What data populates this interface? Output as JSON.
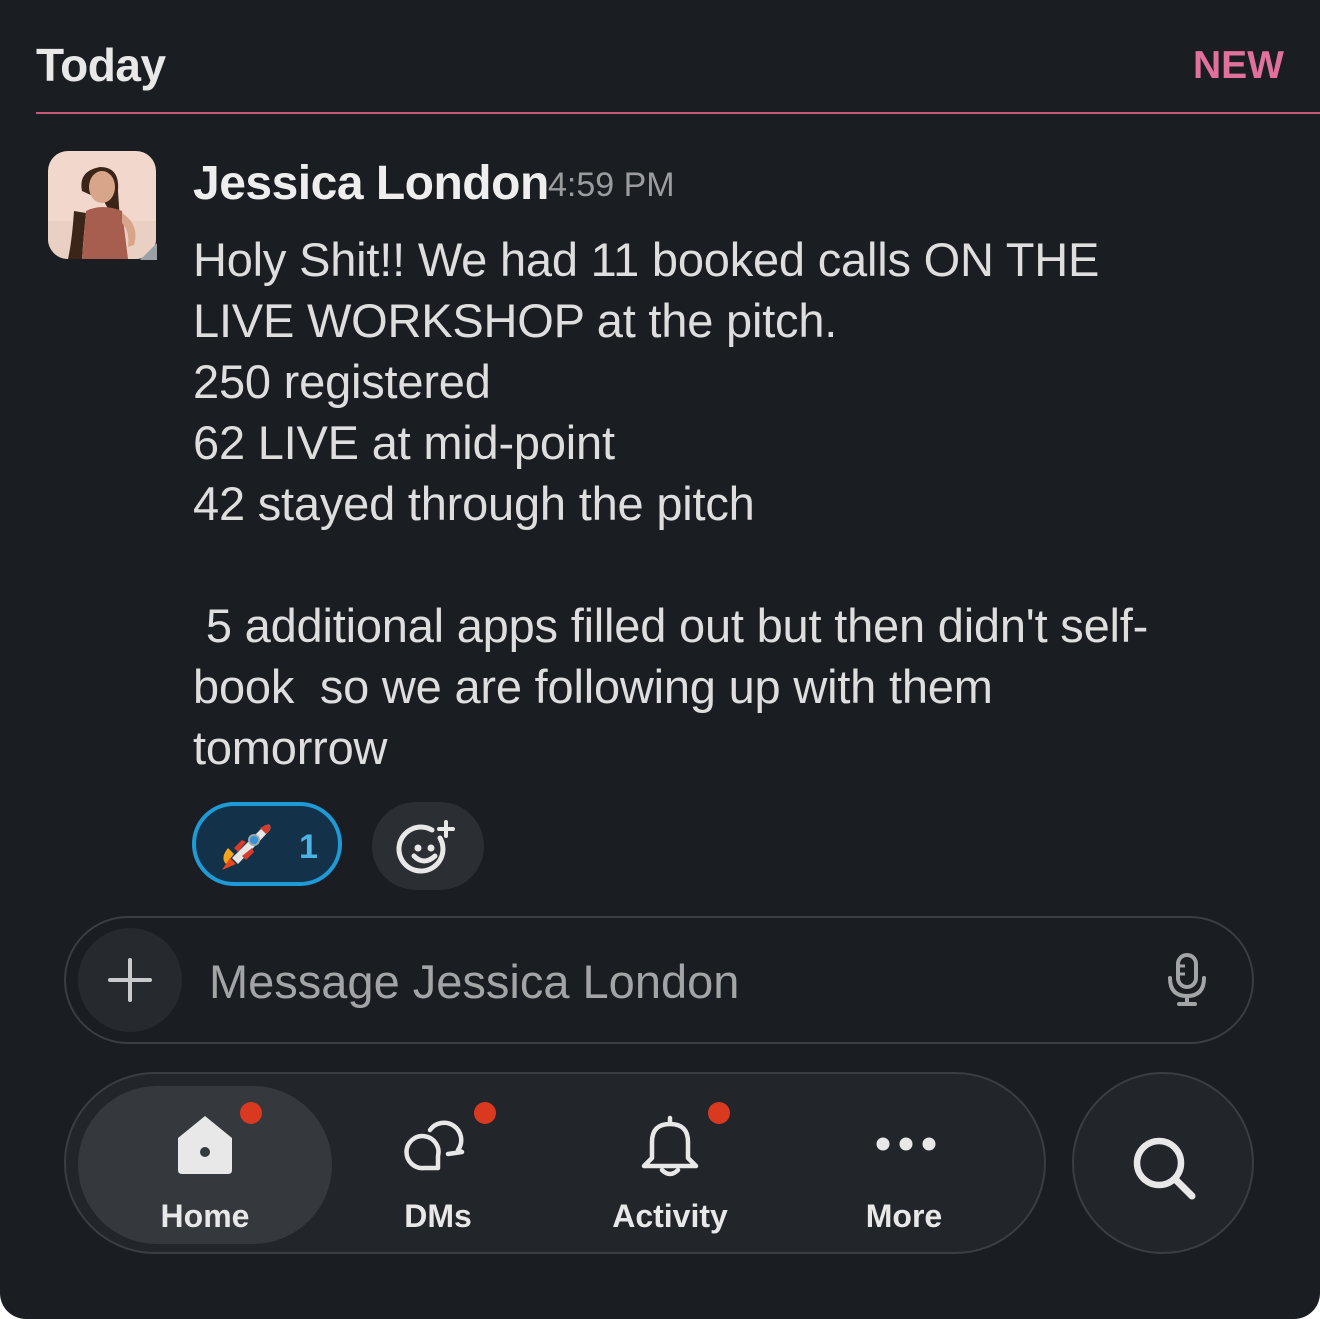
{
  "header": {
    "date_divider": "Today",
    "new_marker": "NEW"
  },
  "message": {
    "sender": "Jessica London",
    "time": "4:59 PM",
    "lines": [
      "Holy Shit!! We had 11 booked calls ON THE",
      "LIVE WORKSHOP at the pitch.",
      "250 registered",
      "62 LIVE at mid-point",
      "42 stayed through the pitch",
      "",
      " 5 additional apps filled out but then didn't self-",
      "book  so we are following up with them",
      "tomorrow"
    ],
    "reactions": [
      {
        "emoji": "rocket-icon",
        "count": "1"
      }
    ]
  },
  "composer": {
    "placeholder": "Message Jessica London"
  },
  "tabbar": {
    "tabs": [
      {
        "label": "Home",
        "icon": "home-icon",
        "active": true,
        "badge": true
      },
      {
        "label": "DMs",
        "icon": "dms-icon",
        "active": false,
        "badge": true
      },
      {
        "label": "Activity",
        "icon": "bell-icon",
        "active": false,
        "badge": true
      },
      {
        "label": "More",
        "icon": "more-icon",
        "active": false,
        "badge": false
      }
    ],
    "search_icon": "search-icon"
  },
  "colors": {
    "background": "#1a1d21",
    "new_accent": "#e0719a",
    "reaction_border": "#1e9bd7",
    "badge": "#d9391f"
  }
}
